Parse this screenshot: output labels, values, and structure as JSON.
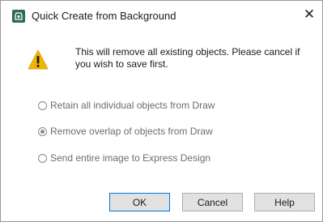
{
  "window": {
    "title": "Quick Create from Background",
    "close_glyph": "✕"
  },
  "message": "This will remove all existing objects. Please cancel if you wish to save first.",
  "options": [
    {
      "label": "Retain all individual objects from Draw",
      "checked": false
    },
    {
      "label": "Remove overlap of objects from Draw",
      "checked": true
    },
    {
      "label": "Send entire image to Express Design",
      "checked": false
    }
  ],
  "buttons": {
    "ok": "OK",
    "cancel": "Cancel",
    "help": "Help"
  },
  "colors": {
    "warning_fill": "#f2b600",
    "default_button_border": "#0078d7",
    "app_icon": "#2e6b4f"
  },
  "icons": {
    "app": "app-icon",
    "warning": "warning-icon",
    "close": "close-icon"
  }
}
